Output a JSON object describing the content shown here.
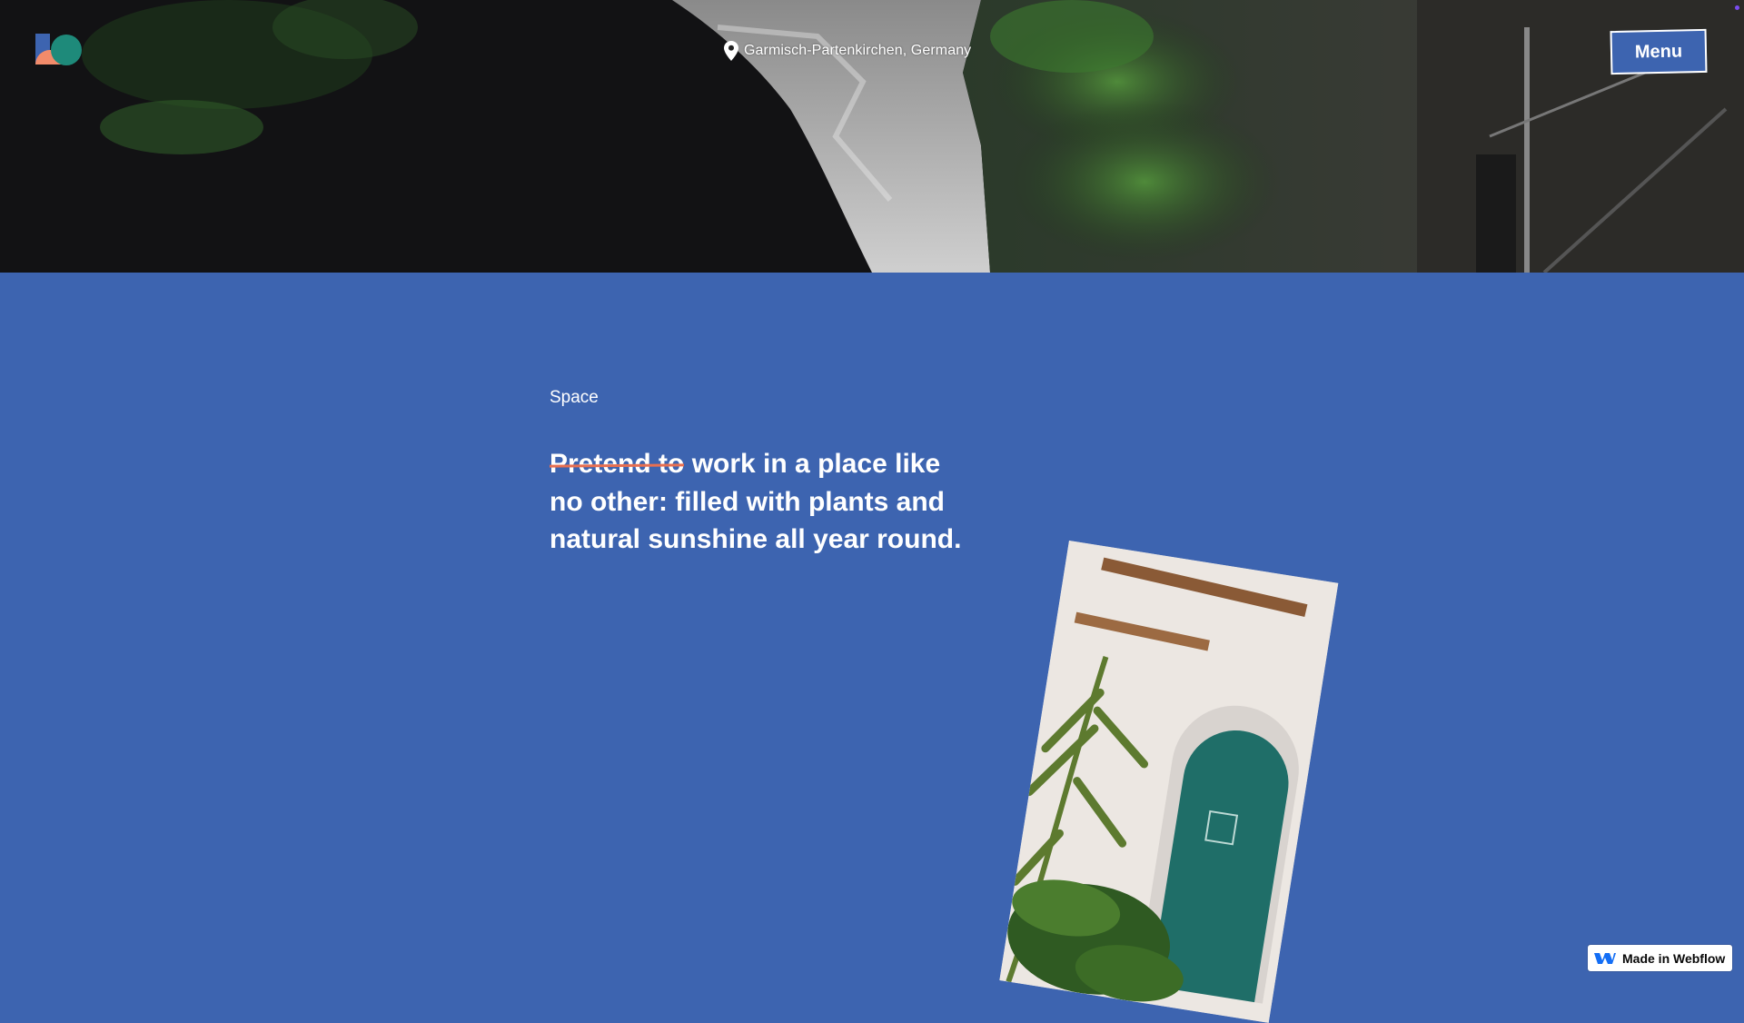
{
  "header": {
    "logo_icon": "brand-logo-icon",
    "location": {
      "icon": "location-pin-icon",
      "label": "Garmisch-Partenkirchen, Germany"
    },
    "menu_label": "Menu"
  },
  "section": {
    "eyebrow": "Space",
    "headline": {
      "struck_text": "Pretend to",
      "text": " work in a place like no other: filled with plants and natural sunshine all year round."
    },
    "photo_icon": "interior-photo"
  },
  "badge": {
    "icon": "webflow-icon",
    "label": "Made in Webflow"
  },
  "colors": {
    "background": "#3d64b0",
    "strike": "#e76f51",
    "text": "#ffffff"
  }
}
